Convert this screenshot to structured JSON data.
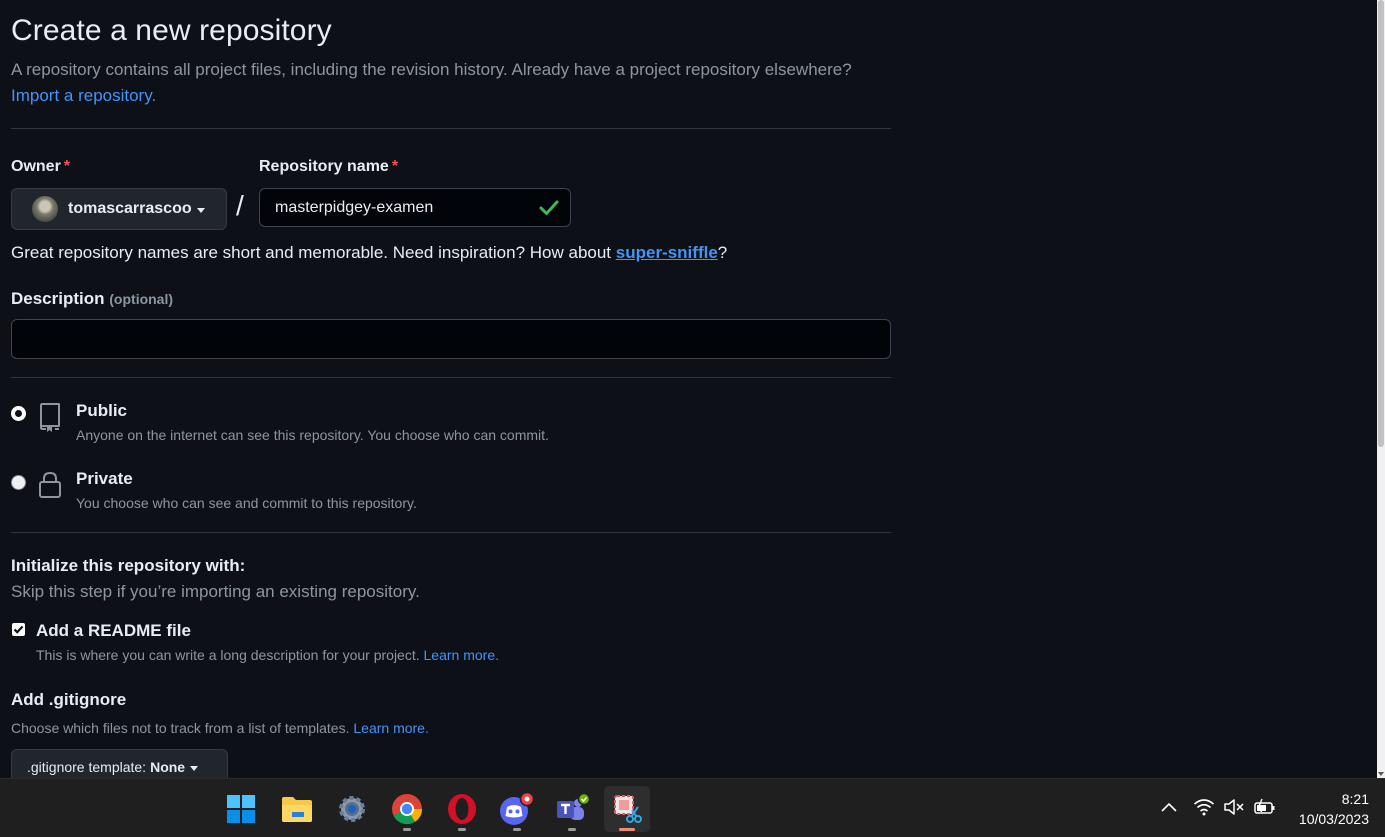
{
  "page": {
    "title": "Create a new repository",
    "lead": "A repository contains all project files, including the revision history. Already have a project repository elsewhere?",
    "import_link": "Import a repository."
  },
  "owner": {
    "label": "Owner",
    "required_mark": "*",
    "value": "tomascarrascoo"
  },
  "repo_name": {
    "label": "Repository name",
    "required_mark": "*",
    "value": "masterpidgey-examen",
    "separator": "/"
  },
  "hint": {
    "prefix": "Great repository names are short and memorable. Need inspiration? How about ",
    "suggestion": "super-sniffle",
    "suffix": "?"
  },
  "description": {
    "label": "Description",
    "optional": "(optional)",
    "value": ""
  },
  "visibility": {
    "selected": "public",
    "public": {
      "title": "Public",
      "desc": "Anyone on the internet can see this repository. You choose who can commit."
    },
    "private": {
      "title": "Private",
      "desc": "You choose who can see and commit to this repository."
    }
  },
  "init": {
    "title": "Initialize this repository with:",
    "subtitle": "Skip this step if you’re importing an existing repository.",
    "readme_label": "Add a README file",
    "readme_checked": true,
    "readme_desc": "This is where you can write a long description for your project.",
    "readme_link": "Learn more."
  },
  "gitignore": {
    "title": "Add .gitignore",
    "desc": "Choose which files not to track from a list of templates.",
    "link": "Learn more.",
    "button_prefix": ".gitignore template:",
    "button_value": "None"
  },
  "taskbar": {
    "apps": [
      "windows-start-icon",
      "file-explorer-icon",
      "settings-icon",
      "chrome-icon",
      "opera-icon",
      "discord-icon",
      "teams-icon",
      "snipping-tool-icon"
    ],
    "time": "8:21",
    "date": "10/03/2023"
  },
  "colors": {
    "background": "#0d1117",
    "link": "#4493f8",
    "required": "#f85149",
    "success": "#3fb950",
    "muted": "#8d96a0"
  }
}
